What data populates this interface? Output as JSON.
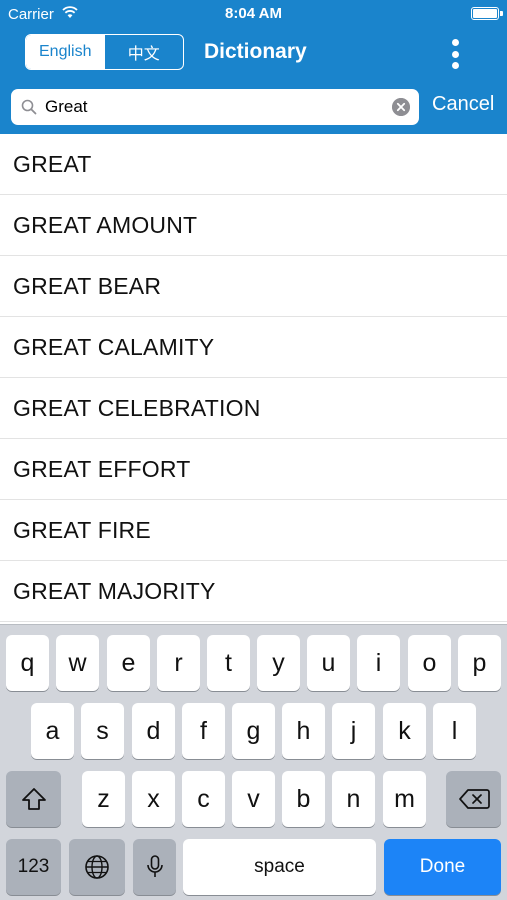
{
  "status_bar": {
    "carrier": "Carrier",
    "time": "8:04 AM"
  },
  "nav": {
    "segments": [
      {
        "label": "English",
        "selected": true
      },
      {
        "label": "中文",
        "selected": false
      }
    ],
    "title": "Dictionary",
    "menu_icon": "more-vertical-icon"
  },
  "search": {
    "value": "Great",
    "cancel_label": "Cancel"
  },
  "results": [
    "GREAT",
    "GREAT AMOUNT",
    "GREAT BEAR",
    "GREAT CALAMITY",
    "GREAT CELEBRATION",
    "GREAT EFFORT",
    "GREAT FIRE",
    "GREAT MAJORITY"
  ],
  "keyboard": {
    "row1": [
      "q",
      "w",
      "e",
      "r",
      "t",
      "y",
      "u",
      "i",
      "o",
      "p"
    ],
    "row2": [
      "a",
      "s",
      "d",
      "f",
      "g",
      "h",
      "j",
      "k",
      "l"
    ],
    "row3": [
      "z",
      "x",
      "c",
      "v",
      "b",
      "n",
      "m"
    ],
    "numbers_label": "123",
    "space_label": "space",
    "done_label": "Done"
  },
  "colors": {
    "brand": "#1a84cc",
    "done_key": "#1c84f7",
    "keyboard_bg": "#d2d5db"
  }
}
